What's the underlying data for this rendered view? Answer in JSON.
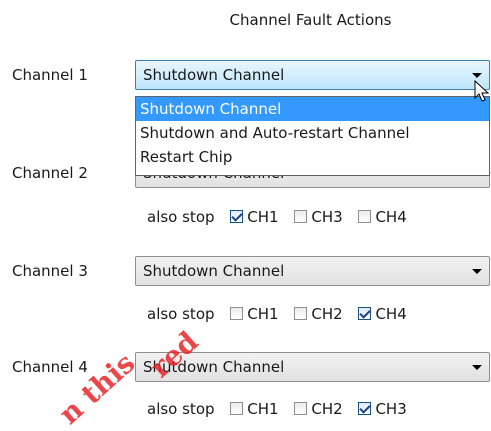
{
  "title": "Channel Fault Actions",
  "channels": [
    {
      "label": "Channel 1",
      "value": "Shutdown Channel"
    },
    {
      "label": "Channel 2",
      "value": "Shutdown Channel"
    },
    {
      "label": "Channel 3",
      "value": "Shutdown Channel"
    },
    {
      "label": "Channel 4",
      "value": "Shutdown Channel"
    }
  ],
  "dropdown_options": [
    "Shutdown Channel",
    "Shutdown and Auto-restart Channel",
    "Restart Chip"
  ],
  "also_stop_label": "also stop",
  "stop_rows": [
    {
      "items": [
        {
          "label": "CH1",
          "checked": true
        },
        {
          "label": "CH3",
          "checked": false
        },
        {
          "label": "CH4",
          "checked": false
        }
      ]
    },
    {
      "items": [
        {
          "label": "CH1",
          "checked": false
        },
        {
          "label": "CH2",
          "checked": false
        },
        {
          "label": "CH4",
          "checked": true
        }
      ]
    },
    {
      "items": [
        {
          "label": "CH1",
          "checked": false
        },
        {
          "label": "CH2",
          "checked": false
        },
        {
          "label": "CH3",
          "checked": true
        }
      ]
    }
  ],
  "watermark": [
    "n this",
    "red"
  ]
}
